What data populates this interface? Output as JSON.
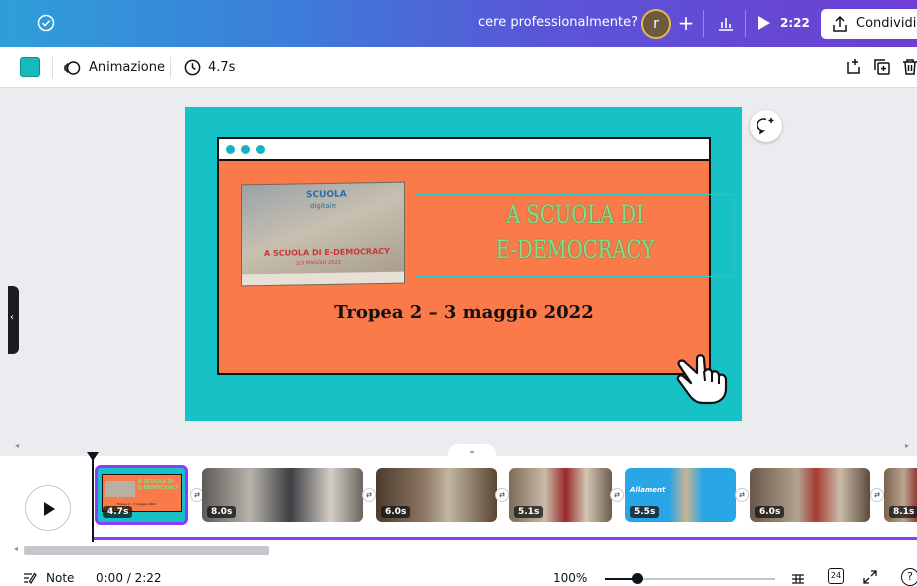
{
  "topbar": {
    "question": "cere professionalmente?",
    "avatar_letter": "r",
    "plus": "+",
    "play_time": "2:22",
    "share_label": "Condividi"
  },
  "toolbar": {
    "swatch_color": "#17b9b9",
    "animation_label": "Animazione",
    "duration": "4.7s"
  },
  "slide": {
    "background": "#17c2c6",
    "inner_background": "#fa7a4a",
    "headline_line1": "A SCUOLA DI",
    "headline_line2": "E-DEMOCRACY",
    "subline": "Tropea 2 – 3 maggio 2022",
    "photo": {
      "title": "SCUOLA",
      "subtitle": "digitale",
      "main": "A SCUOLA DI E-DEMOCRACY",
      "date": "2/3 MAGGIO 2022"
    }
  },
  "timeline": {
    "collapse_glyph": "⌄",
    "clips": [
      {
        "duration": "4.7s",
        "mini_headline": "A SCUOLA DI E-DEMOCRACY",
        "mini_subline": "Tropea 2 – 3 maggio 2022"
      },
      {
        "duration": "8.0s"
      },
      {
        "duration": "6.0s"
      },
      {
        "duration": "5.1s"
      },
      {
        "duration": "5.5s",
        "label": "Allament"
      },
      {
        "duration": "6.0s"
      },
      {
        "duration": "8.1s"
      }
    ]
  },
  "footer": {
    "note_label": "Note",
    "time": "0:00 / 2:22",
    "zoom": "100%",
    "zoom_fraction": 0.19,
    "pages": "24",
    "help": "?"
  }
}
